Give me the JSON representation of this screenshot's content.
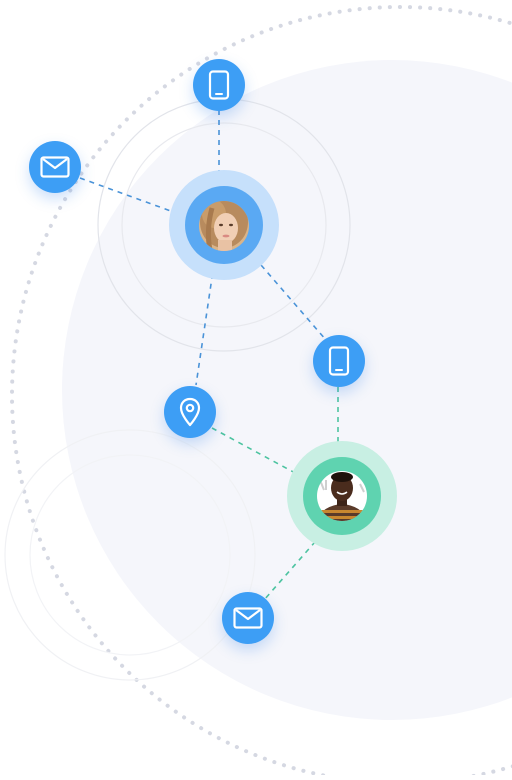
{
  "colors": {
    "background": "#ffffff",
    "bg_blob": "#f5f6fb",
    "dotted_ring": "#d5d8e2",
    "thin_ring": "#e2e4ea",
    "node_blue": "#3d9ef5",
    "blue_halo_outer": "#c6e0fb",
    "blue_halo_inner": "#5aa9f3",
    "teal_halo_outer": "#c8efe3",
    "teal_halo_inner": "#5fd3b0",
    "blue_dash": "#4a93d8",
    "teal_dash": "#4cc3a0",
    "icon_white": "#ffffff"
  },
  "nodes": [
    {
      "id": "phone-top",
      "icon": "phone-icon"
    },
    {
      "id": "mail-left",
      "icon": "mail-icon"
    },
    {
      "id": "avatar-woman",
      "icon": "avatar-portrait"
    },
    {
      "id": "phone-right",
      "icon": "phone-icon"
    },
    {
      "id": "location",
      "icon": "location-pin-icon"
    },
    {
      "id": "avatar-man",
      "icon": "avatar-portrait"
    },
    {
      "id": "mail-bottom",
      "icon": "mail-icon"
    }
  ],
  "links": [
    {
      "from": "phone-top",
      "to": "avatar-woman",
      "style": "blue-dashed"
    },
    {
      "from": "mail-left",
      "to": "avatar-woman",
      "style": "blue-dashed"
    },
    {
      "from": "avatar-woman",
      "to": "phone-right",
      "style": "blue-dashed"
    },
    {
      "from": "avatar-woman",
      "to": "location",
      "style": "blue-dashed"
    },
    {
      "from": "phone-right",
      "to": "avatar-man",
      "style": "teal-dashed"
    },
    {
      "from": "location",
      "to": "avatar-man",
      "style": "teal-dashed"
    },
    {
      "from": "avatar-man",
      "to": "mail-bottom",
      "style": "teal-dashed"
    }
  ]
}
